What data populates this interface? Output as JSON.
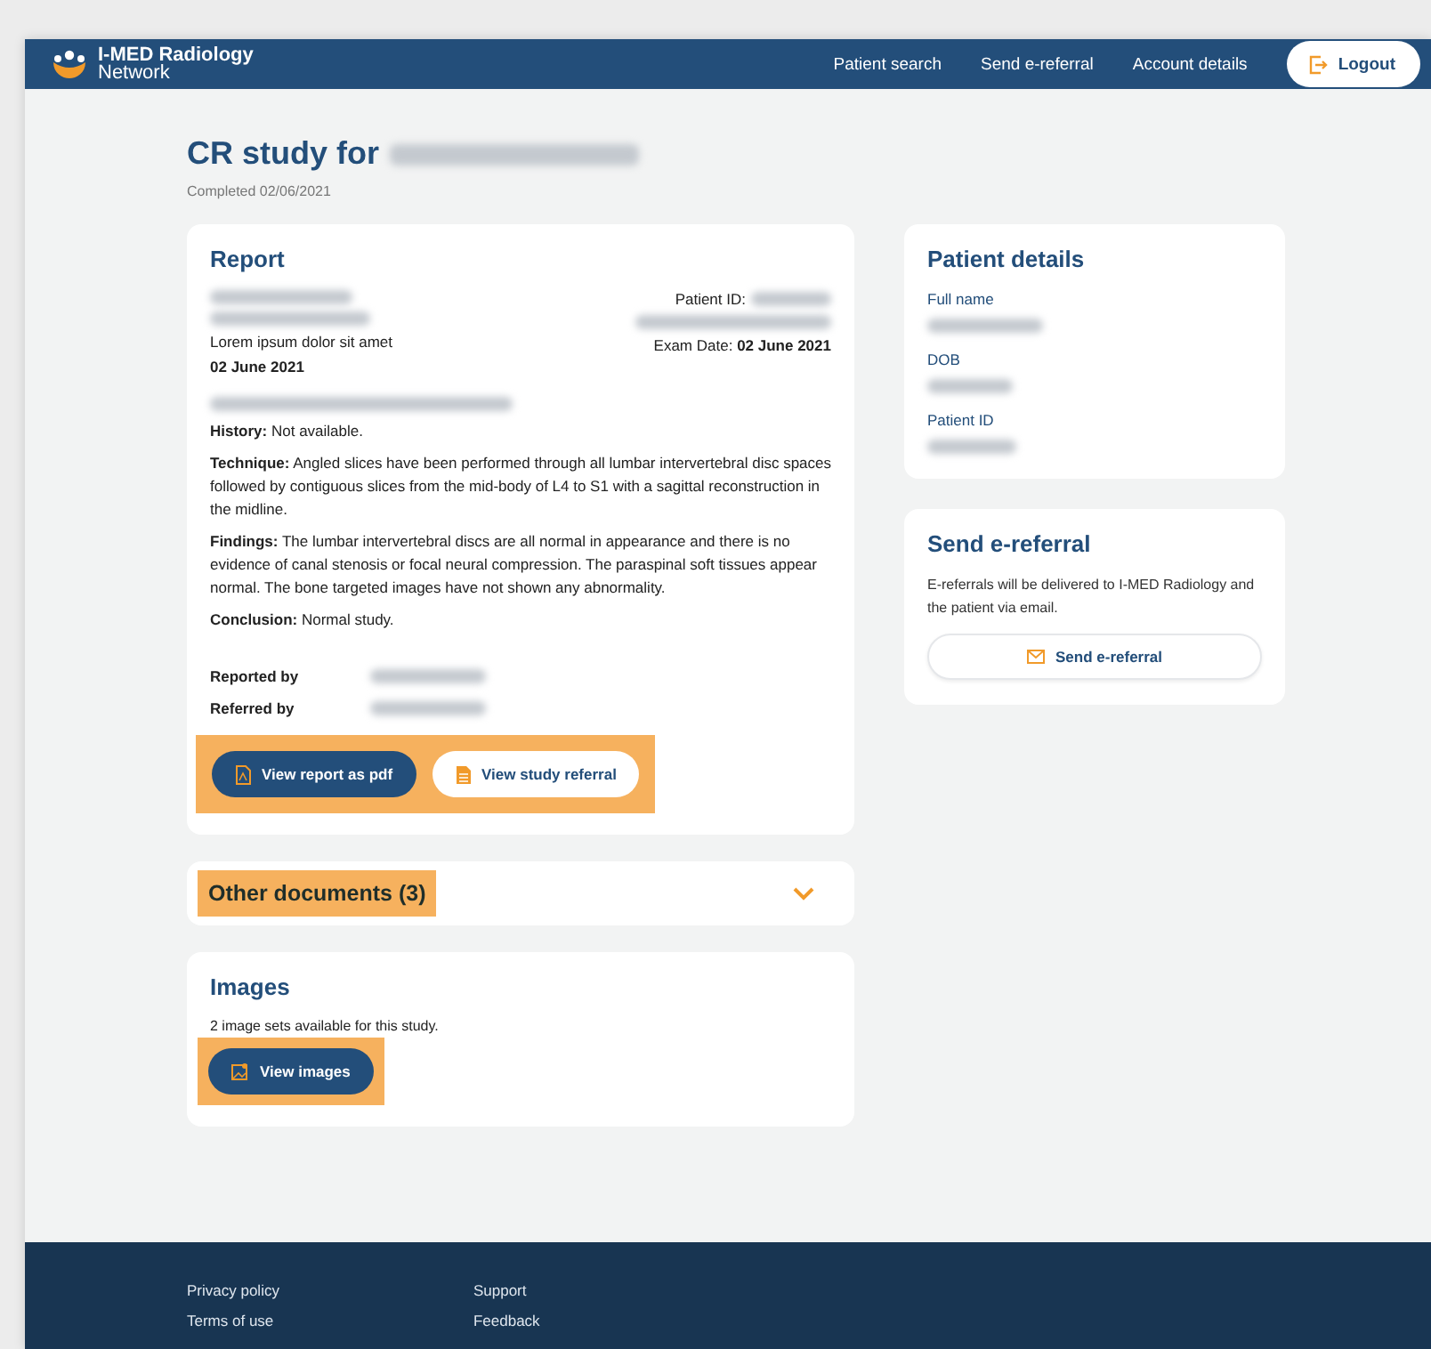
{
  "header": {
    "brand": "I-MED Radiology",
    "brand_sub": "Network",
    "nav": [
      "Patient search",
      "Send e-referral",
      "Account details"
    ],
    "logout": "Logout"
  },
  "page": {
    "title": "CR study for",
    "status": "Completed 02/06/2021"
  },
  "report": {
    "title": "Report",
    "patient_id_label": "Patient ID:",
    "address_line": "Lorem ipsum dolor sit amet",
    "report_date": "02 June 2021",
    "exam_date": "Exam Date: **02 June 2021**",
    "sections": [
      "**History:**  Not available.",
      "**Technique:**  Angled slices have been performed through all lumbar intervertebral disc spaces followed by contiguous slices from the mid-body of L4 to S1 with a sagittal reconstruction in the midline.",
      "**Findings:**  The lumbar intervertebral discs are all normal in appearance and there is no evidence of canal stenosis or focal neural compression.  The paraspinal soft tissues appear normal.  The bone targeted images have not shown any abnormality.",
      "**Conclusion:**  Normal study."
    ],
    "signoff": [
      "Reported by",
      "Referred by"
    ],
    "actions_highlighted": true,
    "actions": [
      {
        "label": "View report as pdf",
        "kind": "primary"
      },
      {
        "label": "View study referral",
        "kind": "secondary"
      }
    ]
  },
  "other_documents": {
    "title": "Other documents (3)",
    "expanded": false,
    "highlighted": true
  },
  "images": {
    "title": "Images",
    "text": "2 image sets available for this study.",
    "action": "View images",
    "highlighted": true
  },
  "patient_details": {
    "title": "Patient details",
    "fields": [
      "Full name",
      "DOB",
      "Patient ID"
    ]
  },
  "e_referral": {
    "title": "Send e-referral",
    "text": "E-referrals will be delivered to I-MED Radiology and the patient via email.",
    "button": "Send e-referral"
  },
  "footer": {
    "columns": [
      [
        "Privacy policy",
        "Terms of use"
      ],
      [
        "Support",
        "Feedback"
      ]
    ]
  }
}
